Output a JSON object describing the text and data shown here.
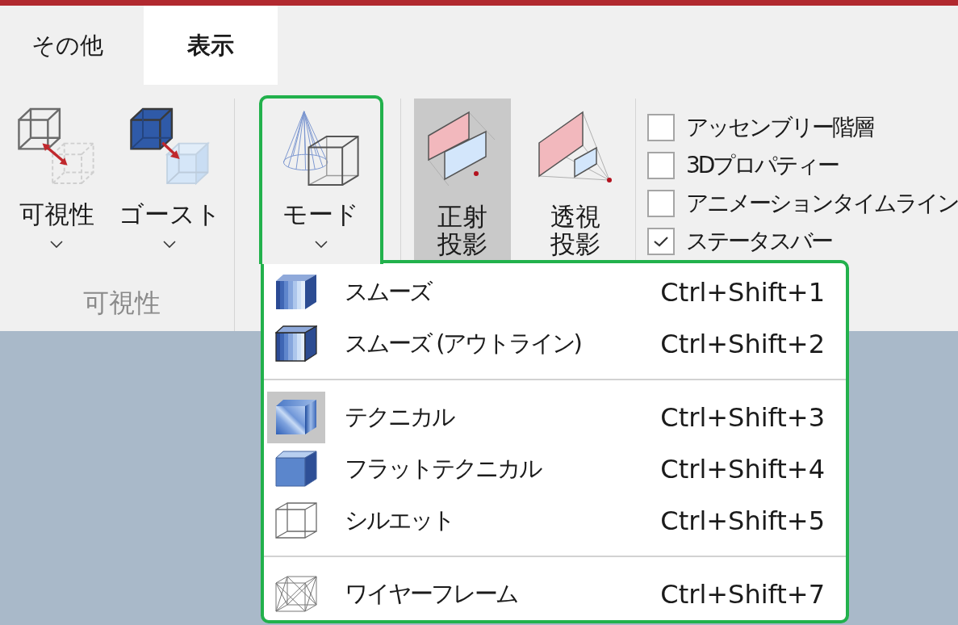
{
  "tabs": [
    {
      "label": "その他",
      "selected": false
    },
    {
      "label": "表示",
      "selected": true
    }
  ],
  "ribbon": {
    "groups": [
      {
        "kind": "buttons",
        "label": "可視性",
        "buttons": [
          {
            "label": "可視性",
            "dropdown": true,
            "selected": false
          },
          {
            "label": "ゴースト",
            "dropdown": true,
            "selected": false
          }
        ]
      },
      {
        "kind": "buttons",
        "buttons": [
          {
            "label": "モード",
            "dropdown": true,
            "selected": false,
            "outlined": true
          }
        ]
      },
      {
        "kind": "buttons",
        "buttons": [
          {
            "label": "正射投影",
            "dropdown": false,
            "selected": true
          },
          {
            "label": "透視投影",
            "dropdown": false,
            "selected": false
          }
        ]
      },
      {
        "kind": "checklist",
        "checkboxes": [
          {
            "label": "アッセンブリー階層",
            "checked": false
          },
          {
            "label": "3Dプロパティー",
            "checked": false
          },
          {
            "label": "アニメーションタイムライン",
            "checked": false
          },
          {
            "label": "ステータスバー",
            "checked": true
          }
        ]
      }
    ]
  },
  "mode_menu": {
    "outlined": true,
    "sections": [
      {
        "items": [
          {
            "label": "スムーズ",
            "shortcut": "Ctrl+Shift+1",
            "selected": false
          },
          {
            "label": "スムーズ (アウトライン)",
            "shortcut": "Ctrl+Shift+2",
            "selected": false
          }
        ]
      },
      {
        "items": [
          {
            "label": "テクニカル",
            "shortcut": "Ctrl+Shift+3",
            "selected": true
          },
          {
            "label": "フラットテクニカル",
            "shortcut": "Ctrl+Shift+4",
            "selected": false
          },
          {
            "label": "シルエット",
            "shortcut": "Ctrl+Shift+5",
            "selected": false
          }
        ]
      },
      {
        "items": [
          {
            "label": "ワイヤーフレーム",
            "shortcut": "Ctrl+Shift+7",
            "selected": false
          }
        ]
      }
    ]
  }
}
